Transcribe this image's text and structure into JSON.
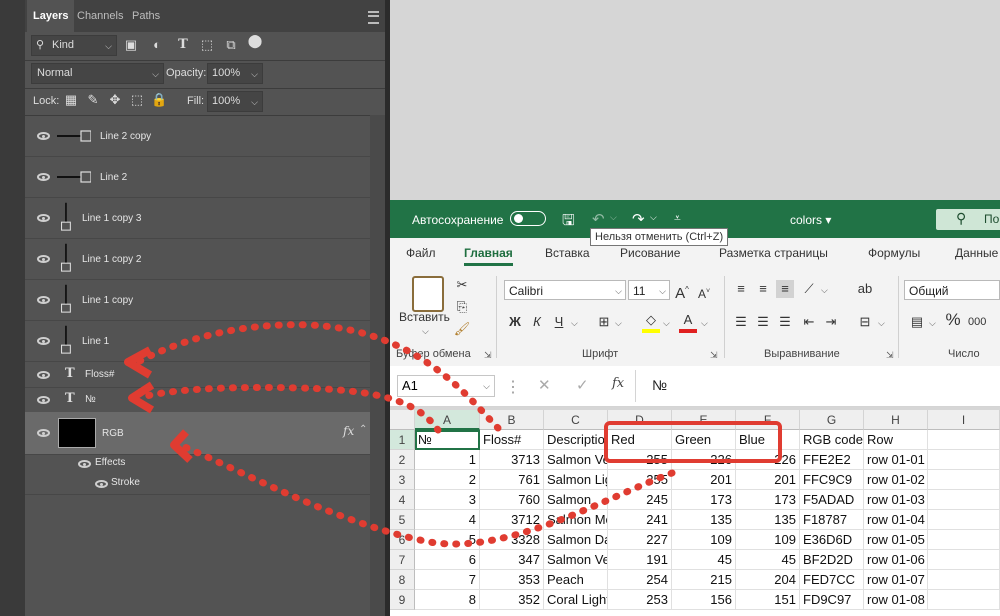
{
  "photoshop": {
    "tabs": [
      "Layers",
      "Channels",
      "Paths"
    ],
    "filter": {
      "label": "Kind"
    },
    "blend_mode": "Normal",
    "opacity": {
      "label": "Opacity:",
      "value": "100%"
    },
    "lock": {
      "label": "Lock:"
    },
    "fill": {
      "label": "Fill:",
      "value": "100%"
    },
    "layers": [
      {
        "name": "Line 2 copy",
        "type": "hline"
      },
      {
        "name": "Line 2",
        "type": "hline"
      },
      {
        "name": "Line 1 copy 3",
        "type": "vline"
      },
      {
        "name": "Line 1 copy 2",
        "type": "vline"
      },
      {
        "name": "Line 1 copy",
        "type": "vline"
      },
      {
        "name": "Line 1",
        "type": "vline"
      },
      {
        "name": "Floss#",
        "type": "text"
      },
      {
        "name": "№",
        "type": "text"
      },
      {
        "name": "RGB",
        "type": "fill",
        "fx": "fx"
      }
    ],
    "effects": {
      "label": "Effects",
      "stroke": "Stroke"
    }
  },
  "excel": {
    "autosave": "Автосохранение",
    "filename": "colors",
    "search_fragment": "По",
    "undo_tooltip": "Нельзя отменить (Ctrl+Z)",
    "menu_tabs": [
      "Файл",
      "Главная",
      "Вставка",
      "Рисование",
      "Разметка страницы",
      "Формулы",
      "Данные"
    ],
    "paste_label": "Вставить",
    "font_name": "Calibri",
    "font_size": "11",
    "number_format": "Общий",
    "groups": {
      "clipboard": "Буфер обмена",
      "font": "Шрифт",
      "alignment": "Выравнивание",
      "number": "Число"
    },
    "font_buttons": {
      "bold": "Ж",
      "italic": "К",
      "underline": "Ч"
    },
    "name_box": "A1",
    "formula_value": "№",
    "fx_label": "fx",
    "columns": [
      "A",
      "B",
      "C",
      "D",
      "E",
      "F",
      "G",
      "H",
      "I"
    ],
    "rows": [
      "1",
      "2",
      "3",
      "4",
      "5",
      "6",
      "7",
      "8",
      "9"
    ],
    "table": [
      [
        "№",
        "Floss#",
        "Description",
        "Red",
        "Green",
        "Blue",
        "RGB code",
        "Row"
      ],
      [
        "1",
        "3713",
        "Salmon Very Light",
        "255",
        "226",
        "226",
        "FFE2E2",
        "row 01-01"
      ],
      [
        "2",
        "761",
        "Salmon Light",
        "255",
        "201",
        "201",
        "FFC9C9",
        "row 01-02"
      ],
      [
        "3",
        "760",
        "Salmon",
        "245",
        "173",
        "173",
        "F5ADAD",
        "row 01-03"
      ],
      [
        "4",
        "3712",
        "Salmon Medium",
        "241",
        "135",
        "135",
        "F18787",
        "row 01-04"
      ],
      [
        "5",
        "3328",
        "Salmon Dark",
        "227",
        "109",
        "109",
        "E36D6D",
        "row 01-05"
      ],
      [
        "6",
        "347",
        "Salmon Very Dark",
        "191",
        "45",
        "45",
        "BF2D2D",
        "row 01-06"
      ],
      [
        "7",
        "353",
        "Peach",
        "254",
        "215",
        "204",
        "FED7CC",
        "row 01-07"
      ],
      [
        "8",
        "352",
        "Coral Light",
        "253",
        "156",
        "151",
        "FD9C97",
        "row 01-08"
      ]
    ],
    "colors": {
      "accent": "#217346",
      "annotation": "#e03c31"
    }
  }
}
